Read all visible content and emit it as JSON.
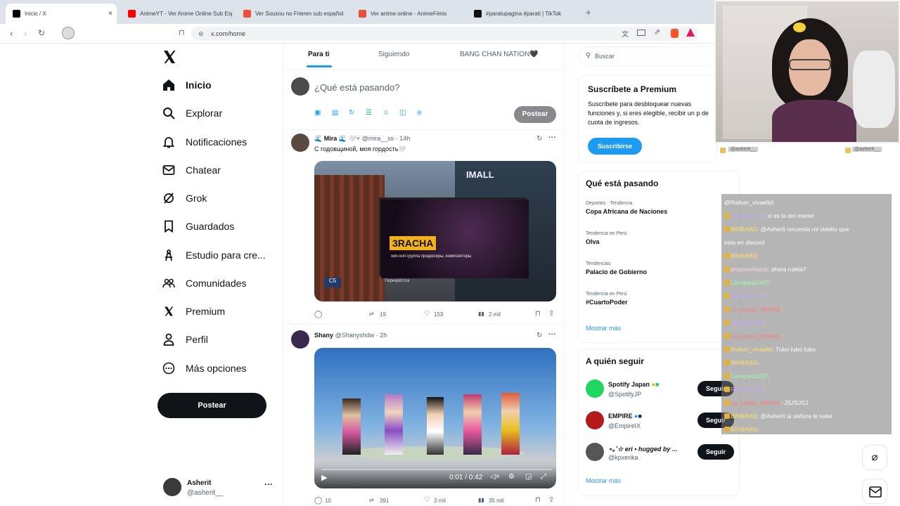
{
  "browser": {
    "tabs": [
      {
        "title": "Inicio / X",
        "active": true
      },
      {
        "title": "AnimeYT - Ver Anime Online Sub Esp"
      },
      {
        "title": "Ver Sousou no Frieren sub español"
      },
      {
        "title": "Ver anime online - AnimeFénix"
      },
      {
        "title": "#paratupagina #parati | TikTok"
      }
    ],
    "new_tab": "+",
    "url": "x.com/home"
  },
  "nav": {
    "items": [
      {
        "label": "Inicio",
        "icon": "home-icon"
      },
      {
        "label": "Explorar",
        "icon": "search-icon"
      },
      {
        "label": "Notificaciones",
        "icon": "bell-icon"
      },
      {
        "label": "Chatear",
        "icon": "mail-icon"
      },
      {
        "label": "Grok",
        "icon": "grok-icon"
      },
      {
        "label": "Guardados",
        "icon": "bookmark-icon"
      },
      {
        "label": "Estudio para cre...",
        "icon": "creator-studio-icon"
      },
      {
        "label": "Comunidades",
        "icon": "communities-icon"
      },
      {
        "label": "Premium",
        "icon": "x-premium-icon"
      },
      {
        "label": "Perfil",
        "icon": "user-icon"
      },
      {
        "label": "Más opciones",
        "icon": "more-circle-icon"
      }
    ],
    "post_button": "Postear",
    "account": {
      "name": "Asherit",
      "handle": "@asherit__"
    }
  },
  "feed": {
    "tabs": [
      "Para ti",
      "Siguiendo",
      "BANG CHAN NATION🖤"
    ],
    "composer_placeholder": "¿Qué está pasando?",
    "post_button": "Postear",
    "tweets": [
      {
        "name": "Mira",
        "handle": "@mira__ss",
        "time": "· 14h",
        "text": "С годовщиной, моя гордость🤍",
        "media_texts": {
          "mall": "IMALL",
          "band": "3RACHA",
          "subtitle": "хип-хоп группа продюсеры, композиторы",
          "store": "Перекрёсток"
        },
        "replies": "",
        "retweets": "19",
        "likes": "153",
        "views": "2 mil"
      },
      {
        "name": "Shany",
        "handle": "@Shanyshdw",
        "time": "· 2h",
        "text": "",
        "video_time": "0:01 / 0:42",
        "replies": "10",
        "retweets": "391",
        "likes": "3 mil",
        "views": "35 mil"
      }
    ]
  },
  "sidebar": {
    "search_placeholder": "Buscar",
    "premium": {
      "title": "Suscríbete a Premium",
      "body": "Suscríbete para desbloquear nuevas funciones y, si eres elegible, recibir un p de cuota de ingresos.",
      "button": "Suscribirse"
    },
    "trends": {
      "title": "Qué está pasando",
      "items": [
        {
          "meta": "Deportes · Tendencia",
          "name": "Copa Africana de Naciones"
        },
        {
          "meta": "Tendencia en Perú",
          "name": "Olva"
        },
        {
          "meta": "Tendencias",
          "name": "Palacio de Gobierno"
        },
        {
          "meta": "Tendencia en Perú",
          "name": "#CuartoPoder"
        }
      ],
      "more": "Mostrar más"
    },
    "follow": {
      "title": "A quién seguir",
      "items": [
        {
          "name": "Spotify Japan",
          "handle": "@SpotifyJP",
          "button": "Seguir"
        },
        {
          "name": "EMPIRE",
          "handle": "@EmpireIX",
          "button": "Seguir"
        },
        {
          "name": "⋆｡˚☆ eri • hugged by ...",
          "handle": "@kpxerika",
          "button": "Seguir"
        }
      ],
      "more": "Mostrar más"
    }
  },
  "stream": {
    "labels": [
      "@asherit__",
      "@asherit__"
    ],
    "chat": [
      {
        "user": "",
        "msg": "@Raikan_vivaelbl)"
      },
      {
        "user": "RulerAran02",
        "msg": ": si es la del meme"
      },
      {
        "user": "BINBIN55",
        "msg": ": @Asherit recuerda mi videito que"
      },
      {
        "user": "",
        "msg": "esta en discord"
      },
      {
        "user": "BINBIN55",
        "msg": ":"
      },
      {
        "user": "angesnefaanji",
        "msg": ": ahora ruleta?"
      },
      {
        "user": "Liampaul1007",
        "msg": ":"
      },
      {
        "user": "RulerAran02",
        "msg": ":"
      },
      {
        "user": "La_panza_deNirito",
        "msg": ":"
      },
      {
        "user": "RulerAran02",
        "msg": ":"
      },
      {
        "user": "La_panza_deNirito",
        "msg": ":"
      },
      {
        "user": "Raikan_vivaelbl",
        "msg": ": Tubo tubo tubo"
      },
      {
        "user": "BINBIN55",
        "msg": ":"
      },
      {
        "user": "Liampaul1007",
        "msg": ":"
      },
      {
        "user": "RulerAran02",
        "msg": ":"
      },
      {
        "user": "La_panza_deNirito",
        "msg": ": JSJSJSJ"
      },
      {
        "user": "BINBIN55",
        "msg": ": @Asherit la señora le sabe"
      },
      {
        "user": "BINBIN55",
        "msg": ":"
      }
    ]
  }
}
